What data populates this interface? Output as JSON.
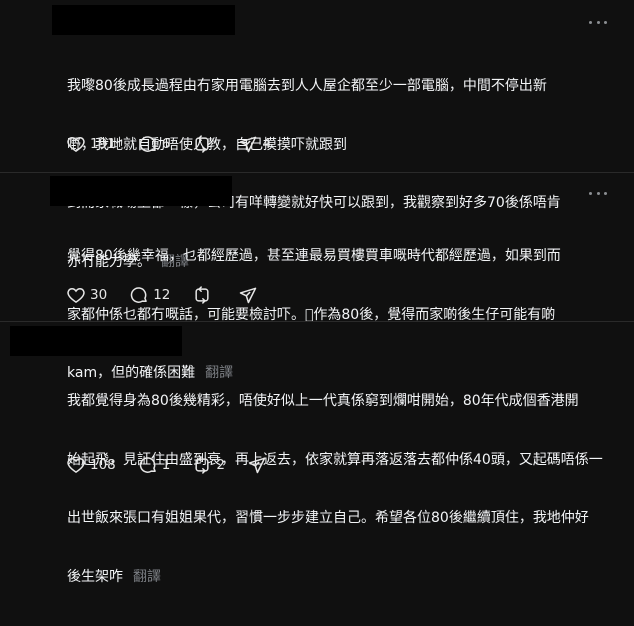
{
  "posts": [
    {
      "text_lines": [
        "我嚟80後成長過程由冇家用電腦去到人人屋企都至少一部電腦，中間不停出新",
        "嘢，我哋就自動唔使人教，自己摸摸吓就跟到",
        "到而家職場上都一樣，公司有咩轉變就好快可以跟到，我觀察到好多70後係唔肯",
        "亦冇能力學。"
      ],
      "translate_label": "翻譯",
      "likes": "191",
      "replies": "6",
      "reposts": "",
      "shares": "4"
    },
    {
      "text_lines": [
        "覺得80後幾幸福，乜都經歷過，甚至連最易買樓買車嘅時代都經歷過，如果到而",
        "家都仲係乜都冇嘅話，可能要檢討吓。\u0000作為80後，覺得而家啲後生仔可能有啲",
        "kam，但的確係困難"
      ],
      "translate_label": "翻譯",
      "likes": "30",
      "replies": "12",
      "reposts": "",
      "shares": ""
    },
    {
      "text_lines": [
        "我都覺得身為80後幾精彩，唔使好似上一代真係窮到爛咁開始，80年代成個香港開",
        "始起飛，見証住由盛到衰，再上返去，依家就算再落返落去都仲係40頭，又起碼唔係一",
        "出世飯來張口有姐姐果代，習慣一步步建立自己。希望各位80後繼續頂住，我地仲好",
        "後生架咋"
      ],
      "translate_label": "翻譯",
      "likes": "108",
      "replies": "1",
      "reposts": "2",
      "shares": ""
    }
  ],
  "icons": {
    "like": "heart-icon",
    "reply": "comment-icon",
    "repost": "repost-icon",
    "share": "send-icon",
    "more": "more-icon"
  }
}
